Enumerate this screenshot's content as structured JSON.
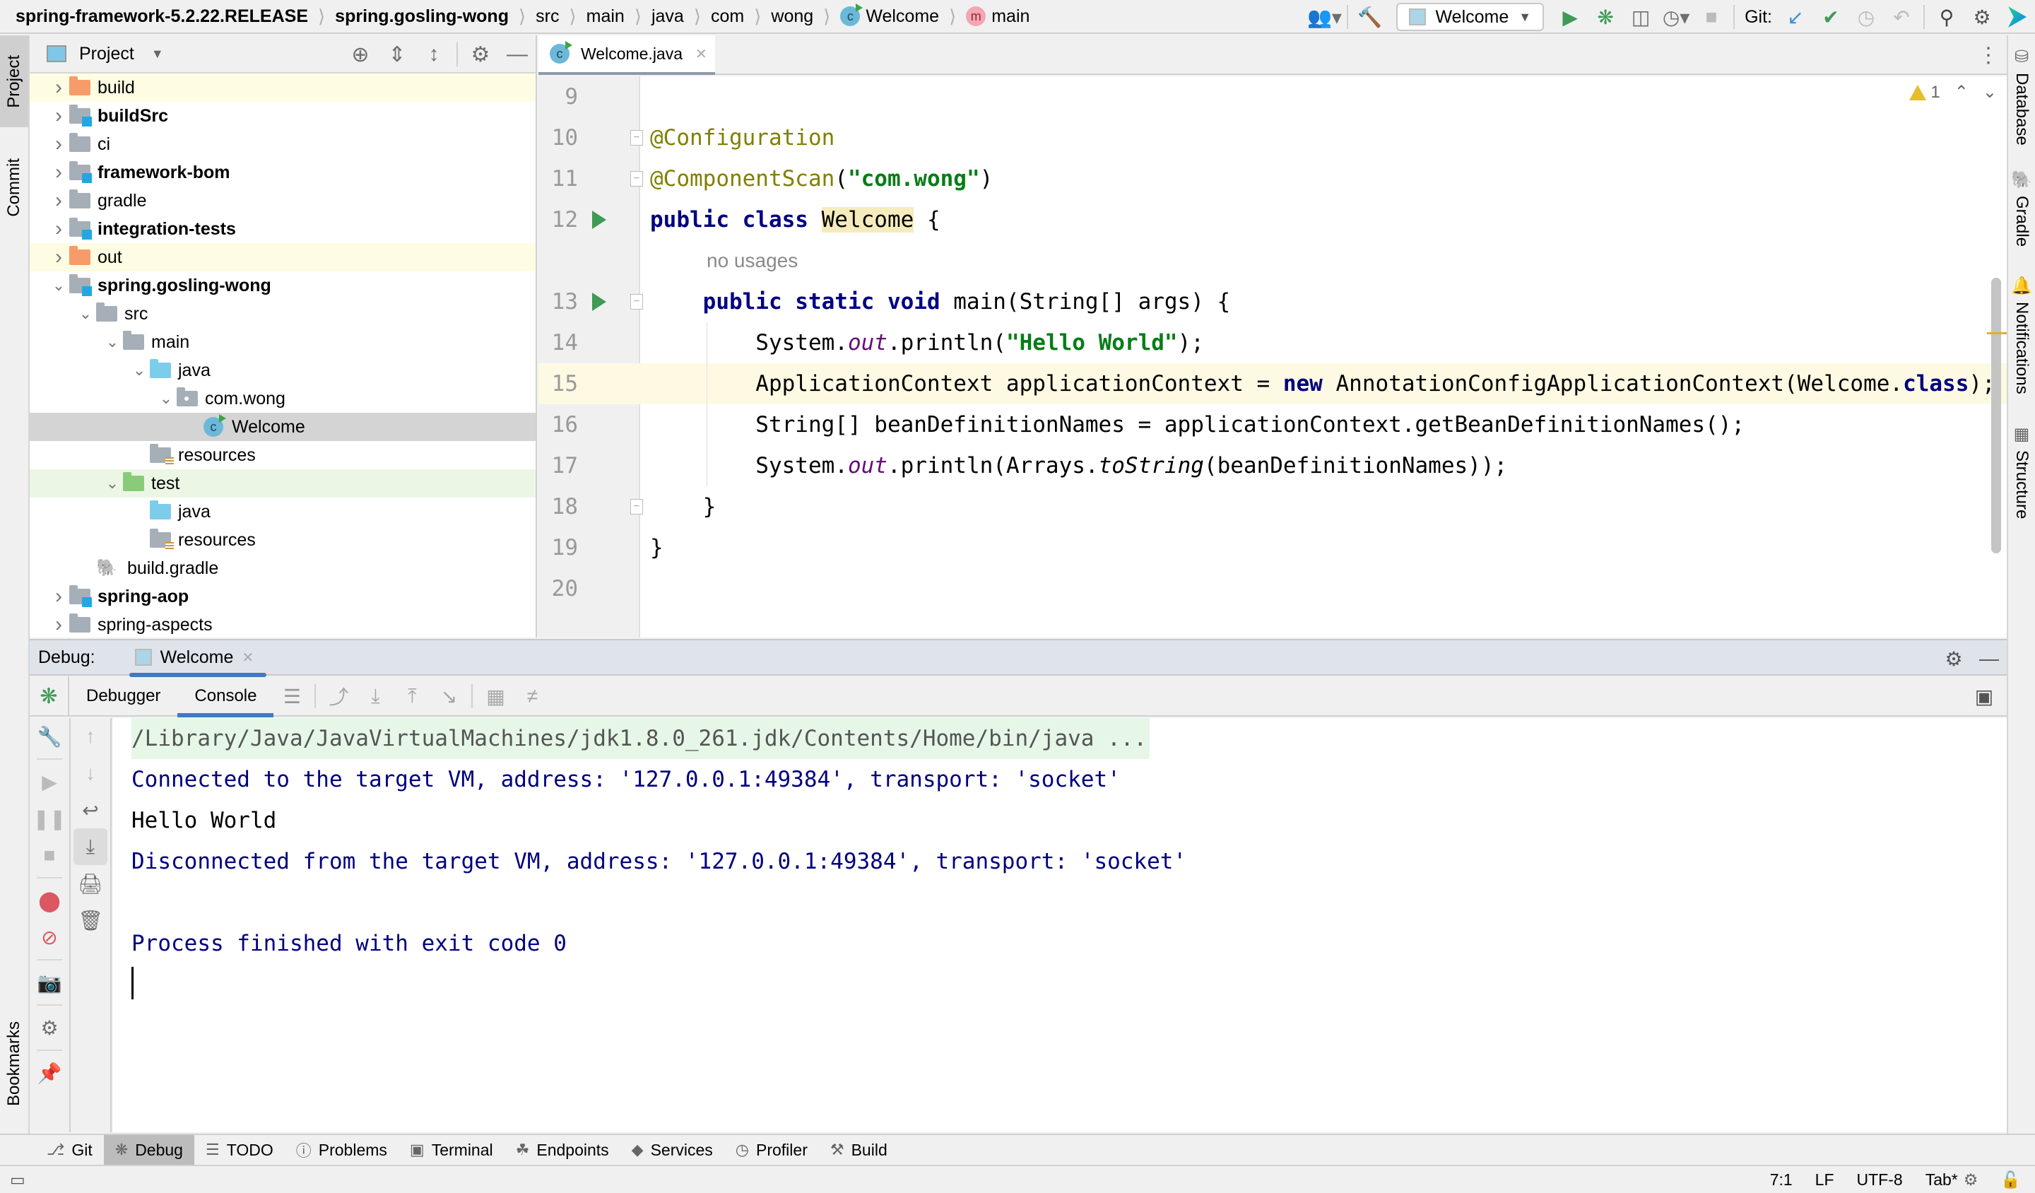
{
  "breadcrumb": {
    "items": [
      {
        "label": "spring-framework-5.2.22.RELEASE",
        "bold": true
      },
      {
        "label": "spring.gosling-wong",
        "bold": true
      },
      {
        "label": "src"
      },
      {
        "label": "main"
      },
      {
        "label": "java"
      },
      {
        "label": "com"
      },
      {
        "label": "wong"
      },
      {
        "label": "Welcome",
        "icon": "class-icon"
      },
      {
        "label": "main",
        "icon": "method-icon"
      }
    ]
  },
  "toolbar": {
    "run_config": "Welcome",
    "git_label": "Git:",
    "icons": [
      "profile-icon",
      "build-hammer-icon",
      "run-icon",
      "debug-icon",
      "coverage-icon",
      "profiler-icon",
      "stop-icon",
      "git-update-icon",
      "git-commit-icon",
      "git-history-icon",
      "git-rollback-icon",
      "search-icon",
      "settings-icon",
      "jetbrains-logo-icon"
    ]
  },
  "left_stripe": {
    "project": "Project",
    "commit": "Commit",
    "bookmarks": "Bookmarks"
  },
  "right_stripe": {
    "database": "Database",
    "gradle": "Gradle",
    "notifications": "Notifications",
    "structure": "Structure"
  },
  "project_panel": {
    "title": "Project",
    "tree": [
      {
        "label": "build",
        "folder": "orange",
        "expand": "collapsed",
        "depth": 0,
        "highlight": "yellow"
      },
      {
        "label": "buildSrc",
        "folder": "module",
        "expand": "collapsed",
        "depth": 0,
        "bold": true
      },
      {
        "label": "ci",
        "folder": "grey",
        "expand": "collapsed",
        "depth": 0
      },
      {
        "label": "framework-bom",
        "folder": "module",
        "expand": "collapsed",
        "depth": 0,
        "bold": true
      },
      {
        "label": "gradle",
        "folder": "grey",
        "expand": "collapsed",
        "depth": 0
      },
      {
        "label": "integration-tests",
        "folder": "module",
        "expand": "collapsed",
        "depth": 0,
        "bold": true
      },
      {
        "label": "out",
        "folder": "orange",
        "expand": "collapsed",
        "depth": 0,
        "highlight": "yellow"
      },
      {
        "label": "spring.gosling-wong",
        "folder": "module",
        "expand": "expanded",
        "depth": 0,
        "bold": true
      },
      {
        "label": "src",
        "folder": "grey",
        "expand": "expanded",
        "depth": 1
      },
      {
        "label": "main",
        "folder": "grey",
        "expand": "expanded",
        "depth": 2
      },
      {
        "label": "java",
        "folder": "blue",
        "expand": "expanded",
        "depth": 3
      },
      {
        "label": "com.wong",
        "folder": "package",
        "expand": "expanded",
        "depth": 4
      },
      {
        "label": "Welcome",
        "folder": "class",
        "expand": "none",
        "depth": 5,
        "selected": true
      },
      {
        "label": "resources",
        "folder": "resources",
        "expand": "none",
        "depth": 3
      },
      {
        "label": "test",
        "folder": "green",
        "expand": "expanded",
        "depth": 2,
        "highlight": "green"
      },
      {
        "label": "java",
        "folder": "blue",
        "expand": "none",
        "depth": 3
      },
      {
        "label": "resources",
        "folder": "resources",
        "expand": "none",
        "depth": 3
      },
      {
        "label": "build.gradle",
        "folder": "gradle",
        "expand": "none",
        "depth": 1
      },
      {
        "label": "spring-aop",
        "folder": "module",
        "expand": "collapsed",
        "depth": 0,
        "bold": true
      },
      {
        "label": "spring-aspects",
        "folder": "grey",
        "expand": "collapsed",
        "depth": 0
      }
    ]
  },
  "editor": {
    "tab": "Welcome.java",
    "warnings": "1",
    "usage_hint": "no usages",
    "lines": [
      {
        "n": "9",
        "html": ""
      },
      {
        "n": "10",
        "html": "<span class='ann'>@Configuration</span>"
      },
      {
        "n": "11",
        "html": "<span class='ann'>@ComponentScan</span>(<span class='str'>\"com.wong\"</span>)"
      },
      {
        "n": "12",
        "html": "<span class='k'>public class</span> <span class='cls-hl'>Welcome</span> {"
      },
      {
        "n": "13",
        "html": "    <span class='k'>public static void</span> main(String[] args) {"
      },
      {
        "n": "14",
        "html": "        System.<span class='fld'>out</span>.println(<span class='str'>\"Hello World\"</span>);"
      },
      {
        "n": "15",
        "html": "        ApplicationContext applicationContext = <span class='k'>new</span> AnnotationConfigApplicationContext(Welcome.<span class='k'>class</span>);"
      },
      {
        "n": "16",
        "html": "        String[] beanDefinitionNames = applicationContext.getBeanDefinitionNames();"
      },
      {
        "n": "17",
        "html": "        System.<span class='fld'>out</span>.println(Arrays.<span class='it'>toString</span>(beanDefinitionNames));"
      },
      {
        "n": "18",
        "html": "    }"
      },
      {
        "n": "19",
        "html": "}"
      },
      {
        "n": "20",
        "html": ""
      }
    ]
  },
  "debug": {
    "title": "Debug:",
    "run_tab": "Welcome",
    "subtabs": [
      "Debugger",
      "Console"
    ],
    "active_subtab": "Console",
    "console": [
      {
        "text": "/Library/Java/JavaVirtualMachines/jdk1.8.0_261.jdk/Contents/Home/bin/java ...",
        "kind": "cmd"
      },
      {
        "text": "Connected to the target VM, address: '127.0.0.1:49384', transport: 'socket'",
        "kind": "sys"
      },
      {
        "text": "Hello World",
        "kind": "out"
      },
      {
        "text": "Disconnected from the target VM, address: '127.0.0.1:49384', transport: 'socket'",
        "kind": "sys"
      },
      {
        "text": "",
        "kind": "out"
      },
      {
        "text": "Process finished with exit code 0",
        "kind": "sys"
      }
    ]
  },
  "bottom_tools": [
    {
      "label": "Git",
      "icon": "git-branch-icon"
    },
    {
      "label": "Debug",
      "icon": "debug-icon",
      "active": true
    },
    {
      "label": "TODO",
      "icon": "list-icon"
    },
    {
      "label": "Problems",
      "icon": "problems-icon"
    },
    {
      "label": "Terminal",
      "icon": "terminal-icon"
    },
    {
      "label": "Endpoints",
      "icon": "endpoints-icon"
    },
    {
      "label": "Services",
      "icon": "services-icon"
    },
    {
      "label": "Profiler",
      "icon": "profiler-icon"
    },
    {
      "label": "Build",
      "icon": "build-hammer-icon"
    }
  ],
  "status_bar": {
    "position": "7:1",
    "line_sep": "LF",
    "encoding": "UTF-8",
    "indent": "Tab*"
  },
  "colors": {
    "accent": "#3d7bc6",
    "run_green": "#3e9a54",
    "warning": "#e9bc2d",
    "keyword": "#000080",
    "string": "#067d17",
    "annotation": "#808000"
  }
}
